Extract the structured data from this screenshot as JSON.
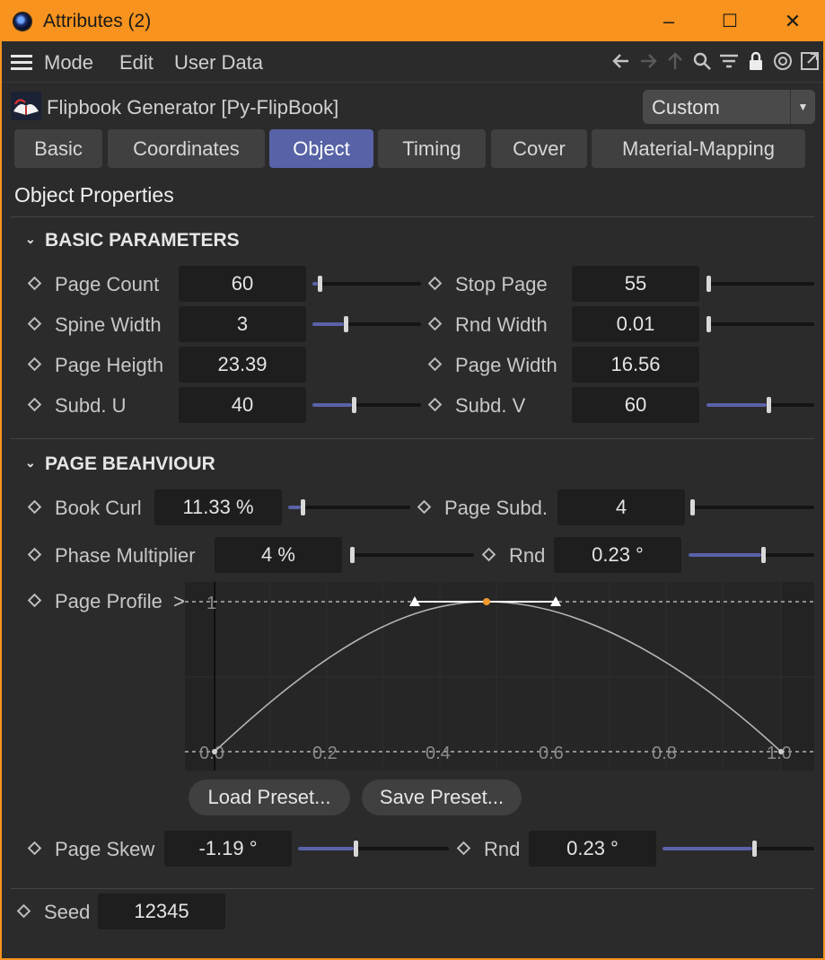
{
  "window": {
    "title": "Attributes (2)",
    "minimize": "–",
    "maximize": "☐",
    "close": "✕"
  },
  "menu": {
    "items": [
      "Mode",
      "Edit",
      "User Data"
    ]
  },
  "toolbar": {
    "icons": [
      "back-arrow-icon",
      "forward-arrow-icon",
      "up-arrow-icon",
      "search-icon",
      "filter-icon",
      "lock-icon",
      "target-icon",
      "new-window-icon"
    ]
  },
  "object": {
    "title": "Flipbook Generator [Py-FlipBook]",
    "mode": "Custom"
  },
  "tabs": [
    "Basic",
    "Coordinates",
    "Object",
    "Timing",
    "Cover",
    "Material-Mapping"
  ],
  "active_tab": "Object",
  "section_title": "Object Properties",
  "basic": {
    "heading": "BASIC PARAMETERS",
    "page_count": {
      "label": "Page Count",
      "value": "60",
      "slider": 0.05
    },
    "stop_page": {
      "label": "Stop Page",
      "value": "55",
      "slider": 0.0
    },
    "spine_width": {
      "label": "Spine Width",
      "value": "3",
      "slider": 0.3
    },
    "rnd_width": {
      "label": "Rnd Width",
      "value": "0.01",
      "slider": 0.0
    },
    "page_height": {
      "label": "Page Heigth",
      "value": "23.39"
    },
    "page_width": {
      "label": "Page Width",
      "value": "16.56"
    },
    "subd_u": {
      "label": "Subd. U",
      "value": "40",
      "slider": 0.38
    },
    "subd_v": {
      "label": "Subd. V",
      "value": "60",
      "slider": 0.58
    }
  },
  "behaviour": {
    "heading": "PAGE BEAHVIOUR",
    "book_curl": {
      "label": "Book Curl",
      "value": "11.33 %",
      "slider": 0.11
    },
    "page_subd": {
      "label": "Page Subd.",
      "value": "4",
      "slider": 0.0
    },
    "phase_multiplier": {
      "label": "Phase Multiplier",
      "value": "4 %",
      "slider": 0.0
    },
    "rnd_phase": {
      "label": "Rnd",
      "value": "0.23 °",
      "slider": 0.6
    },
    "page_profile": {
      "label": "Page Profile",
      "expand_arrow": ">",
      "y_label": "1",
      "x_ticks": [
        "0.0",
        "0.2",
        "0.4",
        "0.6",
        "0.8",
        "1.0"
      ]
    },
    "load_preset": "Load Preset...",
    "save_preset": "Save Preset...",
    "page_skew": {
      "label": "Page Skew",
      "value": "-1.19 °",
      "slider": 0.38
    },
    "rnd_skew": {
      "label": "Rnd",
      "value": "0.23 °",
      "slider": 0.61
    }
  },
  "seed": {
    "label": "Seed",
    "value": "12345"
  }
}
